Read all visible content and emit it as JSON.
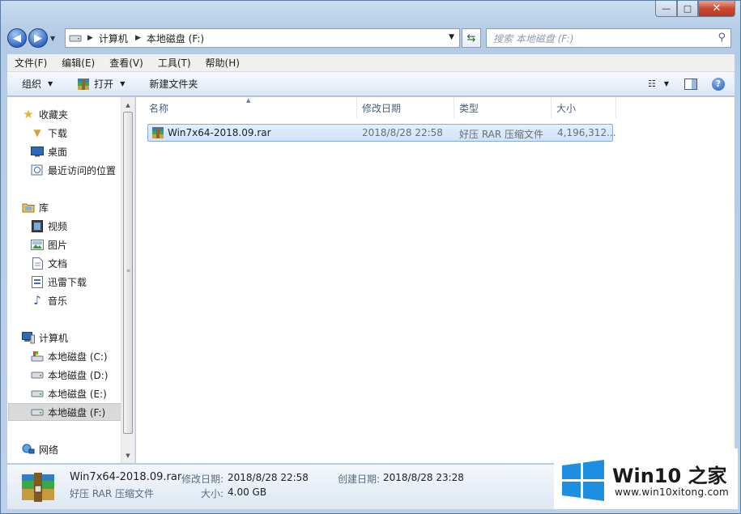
{
  "window": {
    "caption": {
      "minimize": "—",
      "maximize": "□",
      "close": "✕"
    }
  },
  "address": {
    "crumbs": [
      "计算机",
      "本地磁盘 (F:)"
    ],
    "search_placeholder": "搜索 本地磁盘 (F:)"
  },
  "menubar": [
    "文件(F)",
    "编辑(E)",
    "查看(V)",
    "工具(T)",
    "帮助(H)"
  ],
  "toolbar": {
    "organize": "组织",
    "open": "打开",
    "new_folder": "新建文件夹"
  },
  "sidebar": {
    "favorites": {
      "header": "收藏夹",
      "items": [
        "下载",
        "桌面",
        "最近访问的位置"
      ]
    },
    "libraries": {
      "header": "库",
      "items": [
        "视频",
        "图片",
        "文档",
        "迅雷下载",
        "音乐"
      ]
    },
    "computer": {
      "header": "计算机",
      "items": [
        "本地磁盘 (C:)",
        "本地磁盘 (D:)",
        "本地磁盘 (E:)",
        "本地磁盘 (F:)"
      ],
      "selected": "本地磁盘 (F:)"
    },
    "network": {
      "header": "网络"
    }
  },
  "columns": [
    "名称",
    "修改日期",
    "类型",
    "大小"
  ],
  "files": [
    {
      "name": "Win7x64-2018.09.rar",
      "modified": "2018/8/28 22:58",
      "type": "好压 RAR 压缩文件",
      "size": "4,196,312..."
    }
  ],
  "details": {
    "name": "Win7x64-2018.09.rar",
    "type": "好压 RAR 压缩文件",
    "modified_label": "修改日期:",
    "modified": "2018/8/28 22:58",
    "created_label": "创建日期:",
    "created": "2018/8/28 23:28",
    "size_label": "大小:",
    "size": "4.00 GB"
  },
  "watermark": {
    "title": "Win10 之家",
    "url": "www.win10xitong.com"
  },
  "colors": {
    "accent": "#2f6ec4",
    "selection": "#cfe3fb",
    "logo_blue": "#1e8fe0"
  }
}
